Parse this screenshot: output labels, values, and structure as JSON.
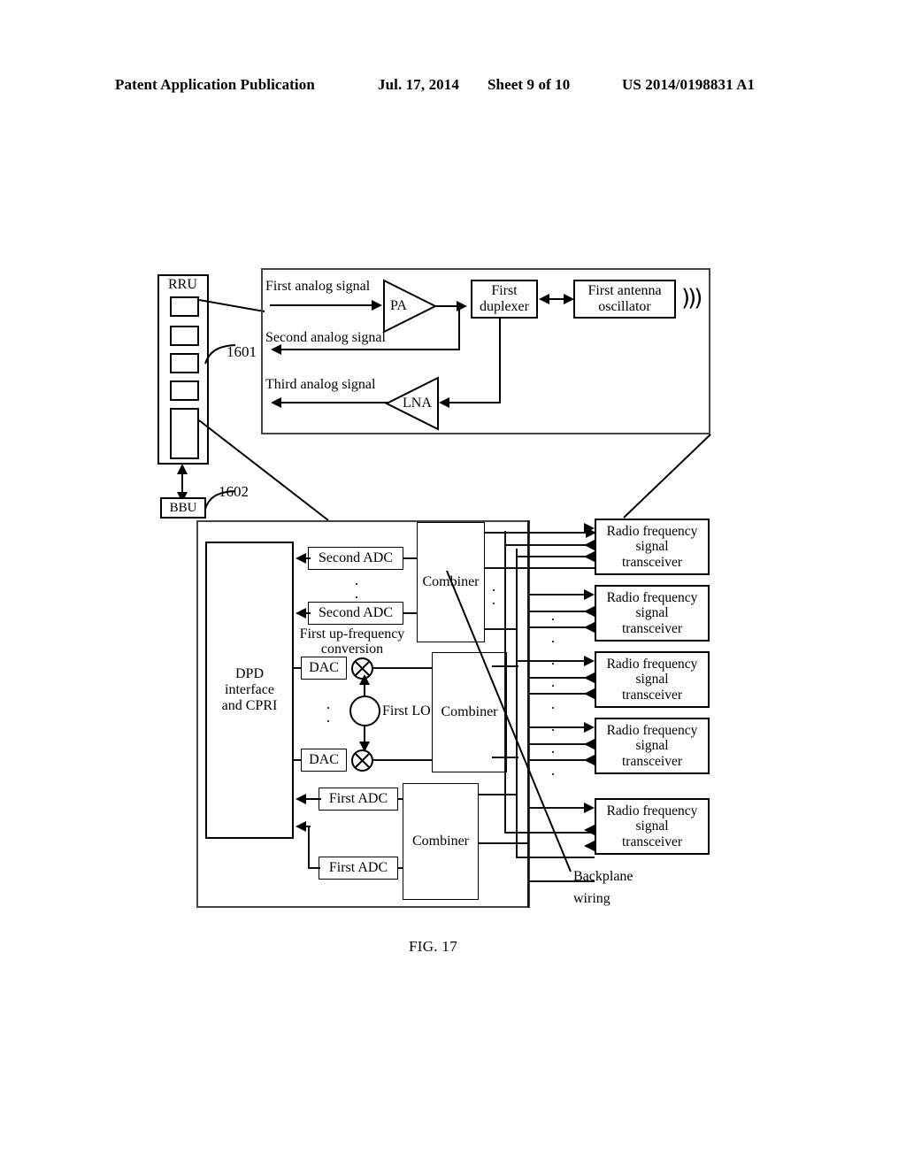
{
  "header": {
    "publication": "Patent Application Publication",
    "date": "Jul. 17, 2014",
    "sheet": "Sheet 9 of 10",
    "patent_number": "US 2014/0198831 A1"
  },
  "figure": {
    "caption": "FIG. 17",
    "reference_numerals": {
      "rru": "1601",
      "bbu": "1602"
    },
    "top_unit": {
      "rru_label": "RRU",
      "signals": [
        {
          "name": "First analog signal",
          "direction": "right"
        },
        {
          "name": "Second analog signal",
          "direction": "left"
        },
        {
          "name": "Third analog signal",
          "direction": "left"
        }
      ],
      "pa_label": "PA",
      "lna_label": "LNA",
      "duplexer_label": "First\nduplexer",
      "duplexer_line1": "First",
      "duplexer_line2": "duplexer",
      "antenna_line1": "First antenna",
      "antenna_line2": "oscillator",
      "radiation_icon": "radiation-waves-icon"
    },
    "bottom_unit": {
      "bbu_label": "BBU",
      "dpd_line1": "DPD",
      "dpd_line2": "interface",
      "dpd_line3": "and CPRI",
      "second_adc_1": "Second ADC",
      "second_adc_2": "Second ADC",
      "upconv_line1": "First up-frequency",
      "upconv_line2": "conversion",
      "dac_1": "DAC",
      "dac_2": "DAC",
      "lo_label": "First LO",
      "first_adc_1": "First ADC",
      "first_adc_2": "First ADC",
      "combiner_1": "Combiner",
      "combiner_2": "Combiner",
      "combiner_3": "Combiner",
      "transceivers": [
        {
          "l1": "Radio frequency",
          "l2": "signal",
          "l3": "transceiver"
        },
        {
          "l1": "Radio frequency",
          "l2": "signal",
          "l3": "transceiver"
        },
        {
          "l1": "Radio frequency",
          "l2": "signal",
          "l3": "transceiver"
        },
        {
          "l1": "Radio frequency",
          "l2": "signal",
          "l3": "transceiver"
        },
        {
          "l1": "Radio frequency",
          "l2": "signal",
          "l3": "transceiver"
        }
      ],
      "backplane_line1": "Backplane",
      "backplane_line2": "wiring"
    },
    "ellipsis": "."
  },
  "colors": {
    "ink": "#000000",
    "shell_stroke": "#444444",
    "paper": "#ffffff"
  }
}
